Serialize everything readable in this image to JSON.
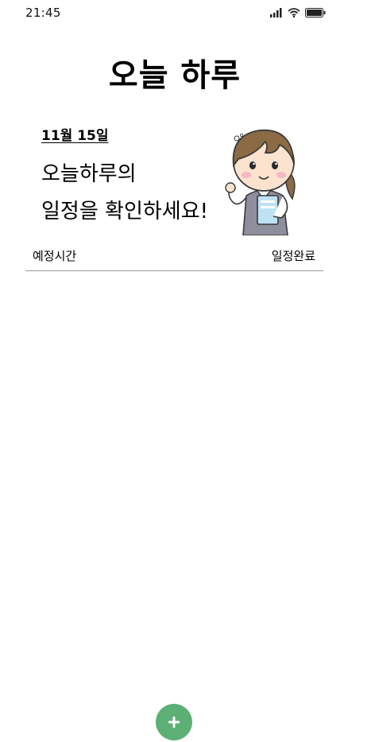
{
  "status_bar": {
    "time": "21:45",
    "icons": [
      "signal-icon",
      "wifi-icon",
      "battery-icon"
    ]
  },
  "header": {
    "title": "오늘 하루"
  },
  "intro": {
    "date": "11월 15일",
    "line1": "오늘하루의",
    "line2": "일정을 확인하세요!"
  },
  "list": {
    "left_header": "예정시간",
    "right_header": "일정완료",
    "items": []
  },
  "fab": {
    "icon": "plus-icon",
    "color": "#5db075"
  }
}
